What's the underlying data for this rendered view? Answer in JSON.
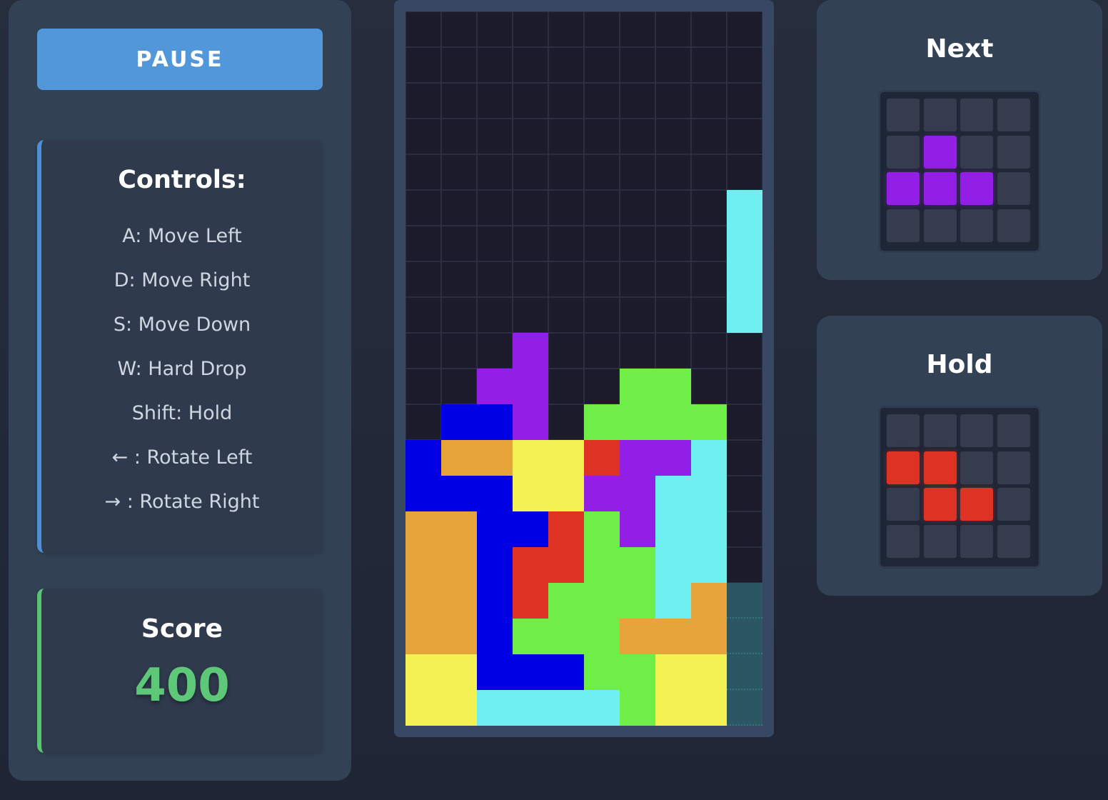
{
  "controls_panel": {
    "pause_label": "PAUSE",
    "controls_title": "Controls:",
    "controls": [
      "A: Move Left",
      "D: Move Right",
      "S: Move Down",
      "W: Hard Drop",
      "Shift: Hold",
      "← : Rotate Left",
      "→ : Rotate Right"
    ],
    "score_title": "Score",
    "score_value": "400"
  },
  "colors": {
    "I": "#6ff0f0",
    "O": "#f3f252",
    "T": "#931fe6",
    "S": "#6fee47",
    "Z": "#dd3224",
    "J": "#0000e4",
    "L": "#e7a43a",
    "empty": "#1b1b2b",
    "ghost": "#2a5761"
  },
  "board": {
    "cols": 10,
    "rows": 20,
    "grid": [
      "..........",
      "..........",
      "..........",
      "..........",
      "..........",
      ".........I",
      ".........I",
      ".........I",
      ".........I",
      "...T......",
      "..TT..SS..",
      ".JJT.SSSS.",
      "JLLOOZTTI.",
      "JJJOOTTII.",
      "LLJJZSTII.",
      "LLJZZSSII.",
      "LLJZSSSILg",
      "LLJSSSLLLg",
      "OOJJJSSOOg",
      "OOIIIISOOg"
    ]
  },
  "next": {
    "title": "Next",
    "grid": [
      "....",
      ".T..",
      "TTT.",
      "...."
    ]
  },
  "hold": {
    "title": "Hold",
    "grid": [
      "....",
      "ZZ..",
      ".ZZ.",
      "...."
    ]
  }
}
